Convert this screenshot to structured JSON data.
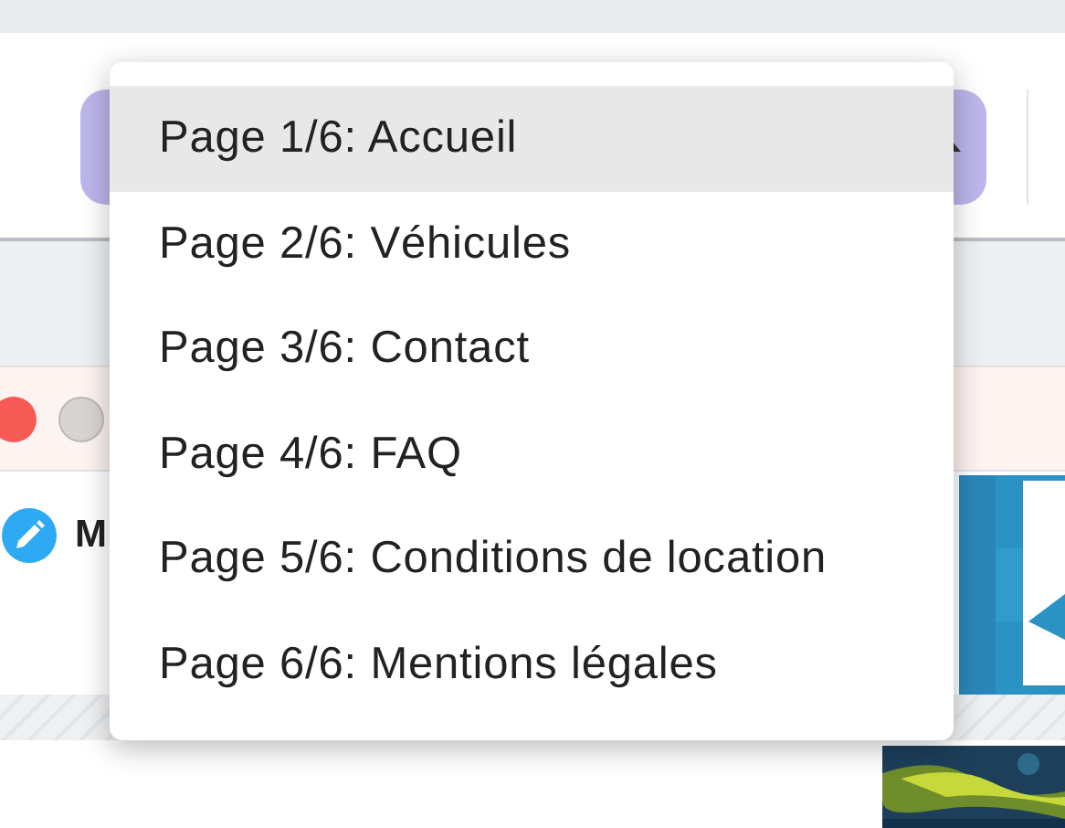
{
  "page": {
    "heading_fragment": "M"
  },
  "menu": {
    "items": [
      {
        "label": "Page 1/6: Accueil",
        "selected": true
      },
      {
        "label": "Page 2/6: Véhicules",
        "selected": false
      },
      {
        "label": "Page 3/6: Contact",
        "selected": false
      },
      {
        "label": "Page 4/6: FAQ",
        "selected": false
      },
      {
        "label": "Page 5/6: Conditions de location",
        "selected": false
      },
      {
        "label": "Page 6/6: Mentions légales",
        "selected": false
      }
    ]
  }
}
